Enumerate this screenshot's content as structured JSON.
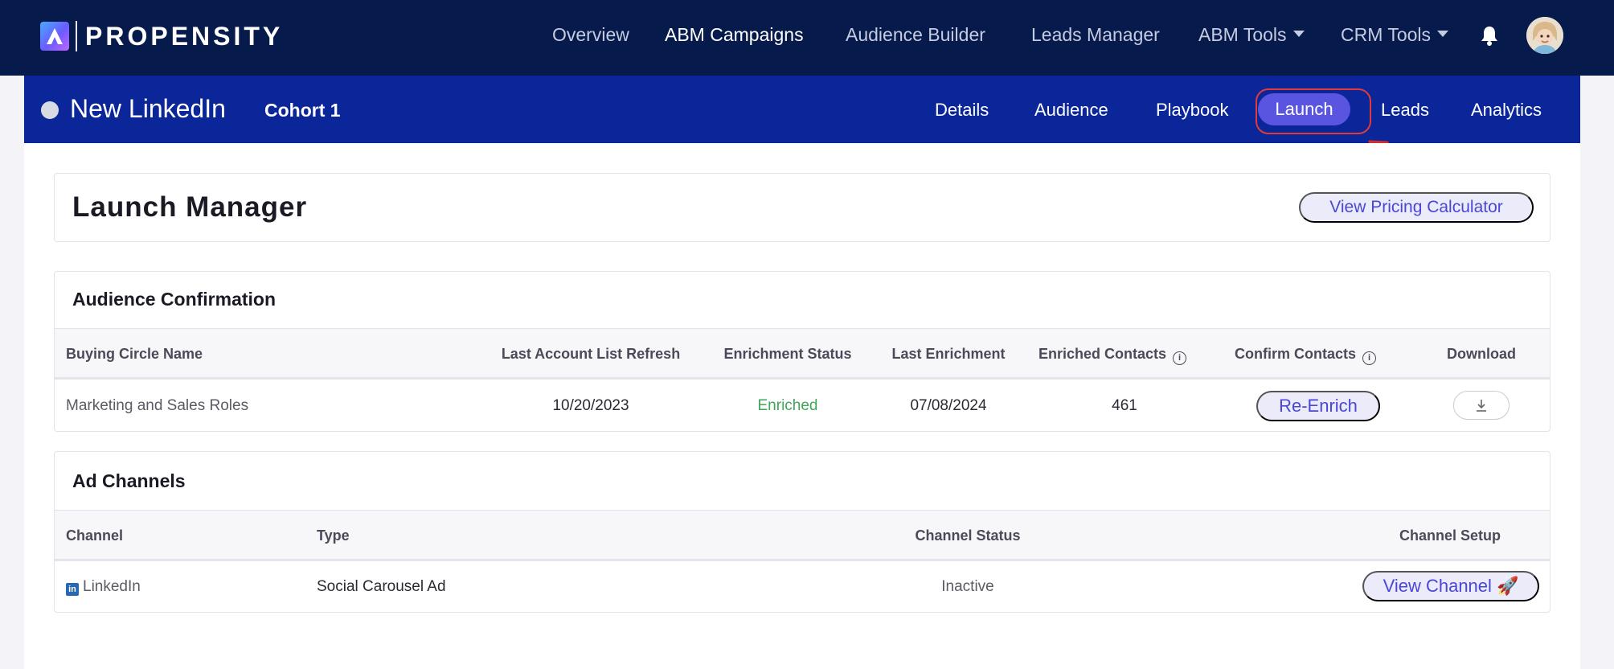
{
  "brand": {
    "name": "PROPENSITY"
  },
  "topnav": {
    "items": [
      {
        "label": "Overview"
      },
      {
        "label": "ABM Campaigns"
      },
      {
        "label": "Audience Builder"
      },
      {
        "label": "Leads Manager"
      },
      {
        "label": "ABM Tools"
      },
      {
        "label": "CRM Tools"
      }
    ]
  },
  "campaign": {
    "name": "New LinkedIn",
    "cohort": "Cohort 1",
    "tabs": [
      {
        "label": "Details"
      },
      {
        "label": "Audience"
      },
      {
        "label": "Playbook"
      },
      {
        "label": "Launch"
      },
      {
        "label": "Leads"
      },
      {
        "label": "Analytics"
      }
    ]
  },
  "launch_manager": {
    "title": "Launch Manager",
    "pricing_button": "View Pricing Calculator"
  },
  "audience_confirmation": {
    "title": "Audience Confirmation",
    "columns": [
      "Buying Circle Name",
      "Last Account List Refresh",
      "Enrichment Status",
      "Last Enrichment",
      "Enriched Contacts",
      "Confirm Contacts",
      "Download"
    ],
    "row": {
      "name": "Marketing and Sales Roles",
      "last_refresh": "10/20/2023",
      "status": "Enriched",
      "last_enrichment": "07/08/2024",
      "contacts": "461",
      "action": "Re-Enrich"
    }
  },
  "ad_channels": {
    "title": "Ad Channels",
    "columns": [
      "Channel",
      "Type",
      "Channel Status",
      "Channel Setup"
    ],
    "row": {
      "channel": "LinkedIn",
      "type": "Social Carousel Ad",
      "status": "Inactive",
      "action": "View Channel 🚀"
    }
  },
  "colors": {
    "topnav_bg": "#061a4c",
    "campaign_bar_bg": "#0b2699",
    "accent": "#4a47d6",
    "enriched": "#3fa65a",
    "highlight": "#e23a3a"
  }
}
